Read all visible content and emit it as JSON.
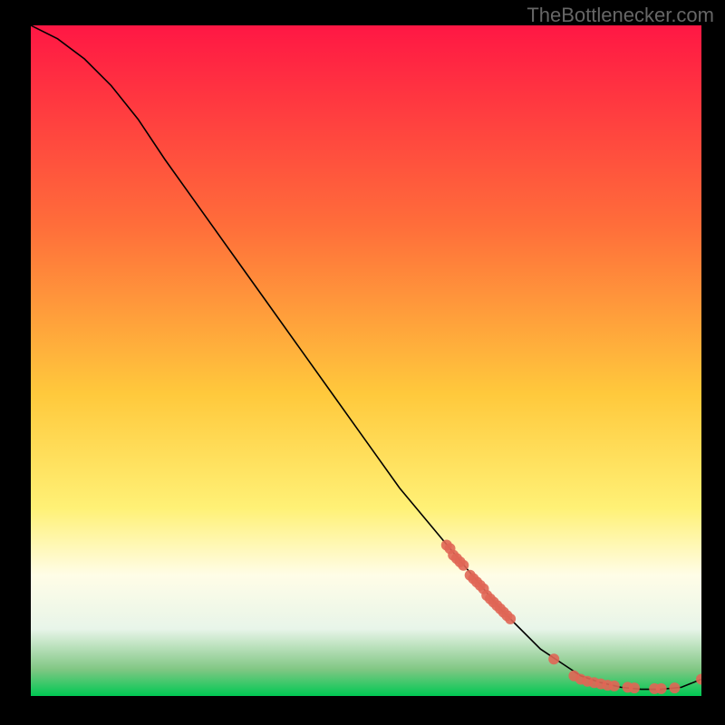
{
  "watermark": "TheBottlenecker.com",
  "chart_data": {
    "type": "line",
    "title": "",
    "xlabel": "",
    "ylabel": "",
    "xlim": [
      0,
      100
    ],
    "ylim": [
      0,
      100
    ],
    "background_gradient": {
      "stops": [
        {
          "offset": 0,
          "color": "#ff1744"
        },
        {
          "offset": 30,
          "color": "#ff6e3a"
        },
        {
          "offset": 55,
          "color": "#ffc93c"
        },
        {
          "offset": 72,
          "color": "#fff176"
        },
        {
          "offset": 82,
          "color": "#fffde7"
        },
        {
          "offset": 90,
          "color": "#e8f5e9"
        },
        {
          "offset": 96,
          "color": "#81c784"
        },
        {
          "offset": 100,
          "color": "#00c853"
        }
      ]
    },
    "series": [
      {
        "name": "curve",
        "type": "line",
        "color": "#000000",
        "x": [
          0,
          4,
          8,
          12,
          16,
          20,
          25,
          30,
          35,
          40,
          45,
          50,
          55,
          60,
          65,
          70,
          73,
          76,
          79,
          82,
          85,
          88,
          91,
          94,
          97,
          100
        ],
        "y": [
          100,
          98,
          95,
          91,
          86,
          80,
          73,
          66,
          59,
          52,
          45,
          38,
          31,
          25,
          19,
          13,
          10,
          7,
          5,
          3,
          2,
          1.3,
          1.0,
          1.0,
          1.3,
          2.5
        ]
      },
      {
        "name": "points",
        "type": "scatter",
        "color": "#e06655",
        "x": [
          62,
          62.5,
          63,
          63.5,
          64,
          64.5,
          65.5,
          66,
          66.5,
          67,
          67.5,
          68,
          68.5,
          69,
          69.5,
          70,
          70.5,
          71,
          71.5,
          78,
          81,
          82,
          83,
          84,
          85,
          86,
          87,
          89,
          90,
          93,
          94,
          96,
          100
        ],
        "y": [
          22.5,
          22,
          21,
          20.5,
          20,
          19.5,
          18,
          17.5,
          17,
          16.5,
          16,
          15,
          14.5,
          14,
          13.5,
          13,
          12.5,
          12,
          11.5,
          5.5,
          3,
          2.5,
          2.2,
          2,
          1.8,
          1.6,
          1.5,
          1.3,
          1.2,
          1.1,
          1.1,
          1.2,
          2.5
        ]
      }
    ]
  }
}
